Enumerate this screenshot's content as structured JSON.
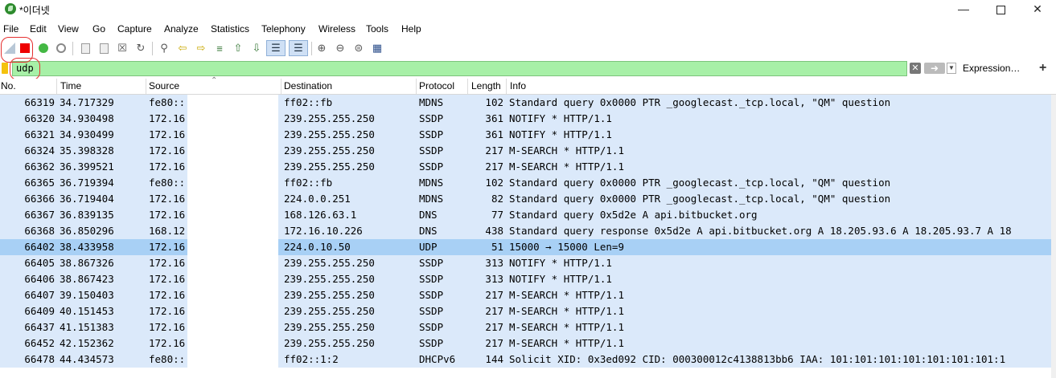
{
  "window": {
    "title": "*이더넷"
  },
  "menu": [
    "File",
    "Edit",
    "View",
    "Go",
    "Capture",
    "Analyze",
    "Statistics",
    "Telephony",
    "Wireless",
    "Tools",
    "Help"
  ],
  "toolbar": {
    "icons": [
      "shark-fin-icon",
      "stop-icon",
      "restart-icon",
      "options-icon",
      "open-icon",
      "save-icon",
      "close-file-icon",
      "reload-icon",
      "find-icon",
      "back-icon",
      "forward-icon",
      "goto-icon",
      "first-icon",
      "last-icon",
      "autoscroll-icon",
      "colorize-icon",
      "zoom-in-icon",
      "zoom-out-icon",
      "zoom-normal-icon",
      "resize-columns-icon"
    ]
  },
  "filter": {
    "value": "udp",
    "expression_label": "Expression…",
    "plus_label": "+"
  },
  "columns": [
    "No.",
    "Time",
    "Source",
    "Destination",
    "Protocol",
    "Length",
    "Info"
  ],
  "packets": [
    {
      "no": "66319",
      "time": "34.717329",
      "src": "fe80::",
      "dst": "ff02::fb",
      "proto": "MDNS",
      "len": "102",
      "info": "Standard query 0x0000 PTR _googlecast._tcp.local, \"QM\" question"
    },
    {
      "no": "66320",
      "time": "34.930498",
      "src": "172.16",
      "dst": "239.255.255.250",
      "proto": "SSDP",
      "len": "361",
      "info": "NOTIFY * HTTP/1.1"
    },
    {
      "no": "66321",
      "time": "34.930499",
      "src": "172.16",
      "dst": "239.255.255.250",
      "proto": "SSDP",
      "len": "361",
      "info": "NOTIFY * HTTP/1.1"
    },
    {
      "no": "66324",
      "time": "35.398328",
      "src": "172.16",
      "dst": "239.255.255.250",
      "proto": "SSDP",
      "len": "217",
      "info": "M-SEARCH * HTTP/1.1"
    },
    {
      "no": "66362",
      "time": "36.399521",
      "src": "172.16",
      "dst": "239.255.255.250",
      "proto": "SSDP",
      "len": "217",
      "info": "M-SEARCH * HTTP/1.1"
    },
    {
      "no": "66365",
      "time": "36.719394",
      "src": "fe80::",
      "dst": "ff02::fb",
      "proto": "MDNS",
      "len": "102",
      "info": "Standard query 0x0000 PTR _googlecast._tcp.local, \"QM\" question"
    },
    {
      "no": "66366",
      "time": "36.719404",
      "src": "172.16",
      "dst": "224.0.0.251",
      "proto": "MDNS",
      "len": "82",
      "info": "Standard query 0x0000 PTR _googlecast._tcp.local, \"QM\" question"
    },
    {
      "no": "66367",
      "time": "36.839135",
      "src": "172.16",
      "dst": "168.126.63.1",
      "proto": "DNS",
      "len": "77",
      "info": "Standard query 0x5d2e A api.bitbucket.org"
    },
    {
      "no": "66368",
      "time": "36.850296",
      "src": "168.12",
      "dst": "172.16.10.226",
      "proto": "DNS",
      "len": "438",
      "info": "Standard query response 0x5d2e A api.bitbucket.org A 18.205.93.6 A 18.205.93.7 A 18"
    },
    {
      "no": "66402",
      "time": "38.433958",
      "src": "172.16",
      "dst": "224.0.10.50",
      "proto": "UDP",
      "len": "51",
      "info": "15000 → 15000 Len=9",
      "selected": true
    },
    {
      "no": "66405",
      "time": "38.867326",
      "src": "172.16",
      "dst": "239.255.255.250",
      "proto": "SSDP",
      "len": "313",
      "info": "NOTIFY * HTTP/1.1"
    },
    {
      "no": "66406",
      "time": "38.867423",
      "src": "172.16",
      "dst": "239.255.255.250",
      "proto": "SSDP",
      "len": "313",
      "info": "NOTIFY * HTTP/1.1"
    },
    {
      "no": "66407",
      "time": "39.150403",
      "src": "172.16",
      "dst": "239.255.255.250",
      "proto": "SSDP",
      "len": "217",
      "info": "M-SEARCH * HTTP/1.1"
    },
    {
      "no": "66409",
      "time": "40.151453",
      "src": "172.16",
      "dst": "239.255.255.250",
      "proto": "SSDP",
      "len": "217",
      "info": "M-SEARCH * HTTP/1.1"
    },
    {
      "no": "66437",
      "time": "41.151383",
      "src": "172.16",
      "dst": "239.255.255.250",
      "proto": "SSDP",
      "len": "217",
      "info": "M-SEARCH * HTTP/1.1"
    },
    {
      "no": "66452",
      "time": "42.152362",
      "src": "172.16",
      "dst": "239.255.255.250",
      "proto": "SSDP",
      "len": "217",
      "info": "M-SEARCH * HTTP/1.1"
    },
    {
      "no": "66478",
      "time": "44.434573",
      "src": "fe80::",
      "dst": "ff02::1:2",
      "proto": "DHCPv6",
      "len": "144",
      "info": "Solicit XID: 0x3ed092 CID: 000300012c4138813bb6 IAA: 101:101:101:101:101:101:101:1"
    }
  ]
}
